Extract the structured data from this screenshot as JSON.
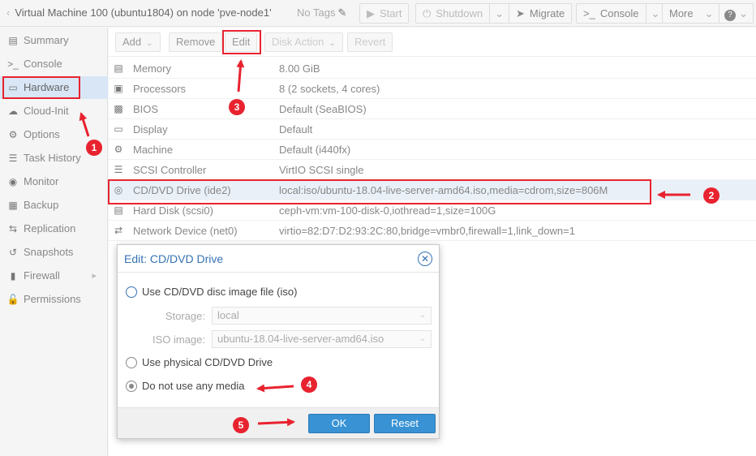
{
  "topbar": {
    "title": "Virtual Machine 100 (ubuntu1804) on node 'pve-node1'",
    "tags": "No Tags",
    "buttons": {
      "start": "Start",
      "shutdown": "Shutdown",
      "migrate": "Migrate",
      "console": "Console",
      "more": "More"
    }
  },
  "sidebar": {
    "items": [
      {
        "label": "Summary",
        "icon": "document-icon"
      },
      {
        "label": "Console",
        "icon": "terminal-icon"
      },
      {
        "label": "Hardware",
        "icon": "monitor-icon"
      },
      {
        "label": "Cloud-Init",
        "icon": "cloud-icon"
      },
      {
        "label": "Options",
        "icon": "gear-icon"
      },
      {
        "label": "Task History",
        "icon": "list-icon"
      },
      {
        "label": "Monitor",
        "icon": "eye-icon"
      },
      {
        "label": "Backup",
        "icon": "floppy-icon"
      },
      {
        "label": "Replication",
        "icon": "retweet-icon"
      },
      {
        "label": "Snapshots",
        "icon": "history-icon"
      },
      {
        "label": "Firewall",
        "icon": "shield-icon"
      },
      {
        "label": "Permissions",
        "icon": "unlock-icon"
      }
    ]
  },
  "toolbar": {
    "add": "Add",
    "remove": "Remove",
    "edit": "Edit",
    "disk_action": "Disk Action",
    "revert": "Revert"
  },
  "hardware": {
    "rows": [
      {
        "name": "Memory",
        "value": "8.00 GiB",
        "icon": "memory-icon"
      },
      {
        "name": "Processors",
        "value": "8 (2 sockets, 4 cores)",
        "icon": "cpu-icon"
      },
      {
        "name": "BIOS",
        "value": "Default (SeaBIOS)",
        "icon": "microchip-icon"
      },
      {
        "name": "Display",
        "value": "Default",
        "icon": "desktop-icon"
      },
      {
        "name": "Machine",
        "value": "Default (i440fx)",
        "icon": "cogs-icon"
      },
      {
        "name": "SCSI Controller",
        "value": "VirtIO SCSI single",
        "icon": "database-icon"
      },
      {
        "name": "CD/DVD Drive (ide2)",
        "value": "local:iso/ubuntu-18.04-live-server-amd64.iso,media=cdrom,size=806M",
        "icon": "disc-icon"
      },
      {
        "name": "Hard Disk (scsi0)",
        "value": "ceph-vm:vm-100-disk-0,iothread=1,size=100G",
        "icon": "hdd-icon"
      },
      {
        "name": "Network Device (net0)",
        "value": "virtio=82:D7:D2:93:2C:80,bridge=vmbr0,firewall=1,link_down=1",
        "icon": "exchange-icon"
      }
    ]
  },
  "dialog": {
    "title": "Edit: CD/DVD Drive",
    "option_iso": "Use CD/DVD disc image file (iso)",
    "storage_label": "Storage:",
    "storage_value": "local",
    "iso_label": "ISO image:",
    "iso_value": "ubuntu-18.04-live-server-amd64.iso",
    "option_physical": "Use physical CD/DVD Drive",
    "option_none": "Do not use any media",
    "selected_option": "Do not use any media",
    "ok": "OK",
    "reset": "Reset"
  },
  "annotations": {
    "steps": [
      "1",
      "2",
      "3",
      "4",
      "5"
    ],
    "color": "#e8232f"
  }
}
